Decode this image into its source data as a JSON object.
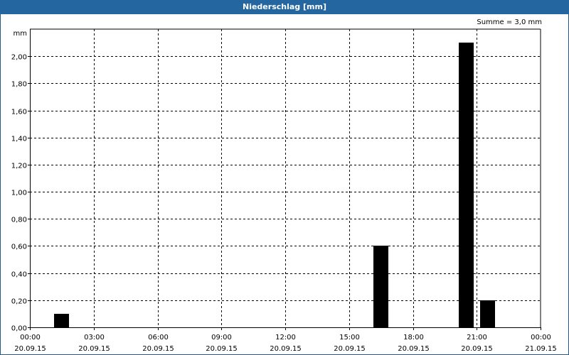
{
  "window": {
    "title": "Niederschlag [mm]"
  },
  "summary": "Summe = 3,0 mm",
  "colors": {
    "title_bg": "#2466a0",
    "title_text": "#ffffff",
    "bars": "#000000",
    "grid": "#000000"
  },
  "chart_data": {
    "type": "bar",
    "title": "Niederschlag [mm]",
    "ylabel": "mm",
    "xlabel": "",
    "ylim": [
      0,
      2.2
    ],
    "grid": true,
    "x_ticks": [
      {
        "time": "00:00",
        "date": "20.09.15",
        "hour": 0
      },
      {
        "time": "03:00",
        "date": "20.09.15",
        "hour": 3
      },
      {
        "time": "06:00",
        "date": "20.09.15",
        "hour": 6
      },
      {
        "time": "09:00",
        "date": "20.09.15",
        "hour": 9
      },
      {
        "time": "12:00",
        "date": "20.09.15",
        "hour": 12
      },
      {
        "time": "15:00",
        "date": "20.09.15",
        "hour": 15
      },
      {
        "time": "18:00",
        "date": "20.09.15",
        "hour": 18
      },
      {
        "time": "21:00",
        "date": "20.09.15",
        "hour": 21
      },
      {
        "time": "00:00",
        "date": "21.09.15",
        "hour": 24
      }
    ],
    "y_ticks": [
      "0,00",
      "0,20",
      "0,40",
      "0,60",
      "0,80",
      "1,00",
      "1,20",
      "1,40",
      "1,60",
      "1,80",
      "2,00"
    ],
    "y_tick_values": [
      0,
      0.2,
      0.4,
      0.6,
      0.8,
      1.0,
      1.2,
      1.4,
      1.6,
      1.8,
      2.0
    ],
    "series": [
      {
        "values": [
          {
            "hour": 1.5,
            "value": 0.1
          },
          {
            "hour": 16.5,
            "value": 0.6
          },
          {
            "hour": 20.5,
            "value": 2.1
          },
          {
            "hour": 21.5,
            "value": 0.2
          }
        ]
      }
    ]
  }
}
